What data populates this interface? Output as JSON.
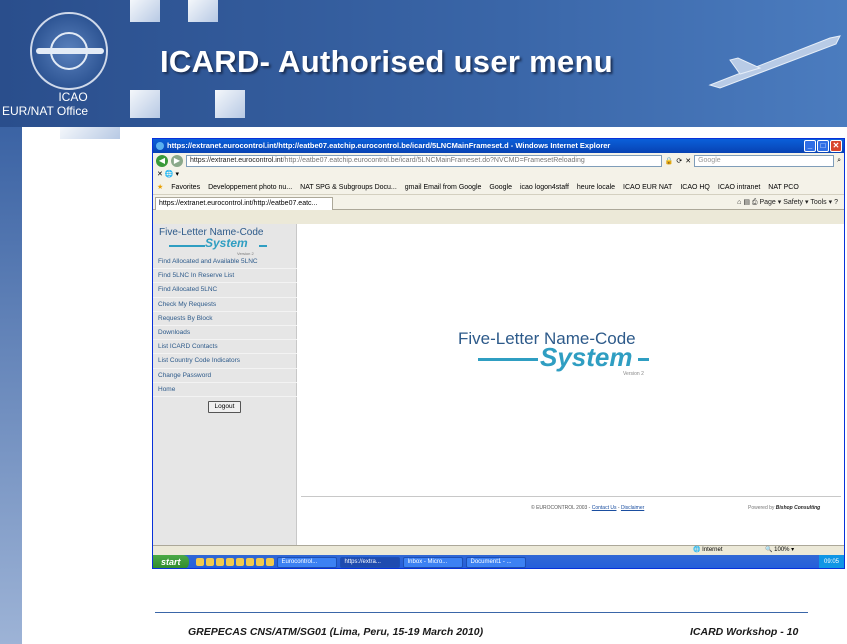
{
  "slide": {
    "title": "ICARD- Authorised user menu",
    "org_label": "ICAO",
    "office_label": "EUR/NAT Office",
    "footer_left": "GREPECAS  CNS/ATM/SG01 (Lima, Peru, 15-19 March 2010)",
    "footer_right": "ICARD Workshop - 10"
  },
  "browser": {
    "window_title": "https://extranet.eurocontrol.int/http://eatbe07.eatchip.eurocontrol.be/icard/5LNCMainFrameset.d - Windows Internet Explorer",
    "url_prefix": "https://extranet.eurocontrol.int",
    "url_rest": "/http://eatbe07.eatchip.eurocontrol.be/icard/5LNCMainFrameset.do?NVCMD=FramesetReloading",
    "search_placeholder": "Google",
    "menu_row": "✕  🌐 ▾",
    "favorites": [
      "Favorites",
      "Developpement photo nu...",
      "NAT SPG & Subgroups Docu...",
      "gmail Email from Google",
      "Google",
      "icao logon4staff",
      "heure locale",
      "ICAO EUR NAT",
      "ICAO HQ",
      "ICAO intranet",
      "NAT PCO"
    ],
    "tab_label": "https://extranet.eurocontrol.int/http://eatbe07.eatc...",
    "command_bar": "Page ▾  Safety ▾  Tools ▾",
    "status_zone": "Internet",
    "status_zoom": "100%"
  },
  "app": {
    "logo_line1": "Five-Letter Name-Code",
    "logo_line2": "System",
    "logo_version": "Version 2",
    "menu": [
      "Find Allocated and Available 5LNC",
      "Find 5LNC In Reserve List",
      "Find Allocated 5LNC",
      "Check My Requests",
      "Requests By Block",
      "Downloads",
      "List ICARD Contacts",
      "List Country Code Indicators",
      "Change Password",
      "Home"
    ],
    "logout_label": "Logout",
    "copyright": "© EUROCONTROL 2003 - ",
    "contact_link": "Contact Us",
    "disclaimer_link": "Disclaimer",
    "powered_by": "Powered by ",
    "powered_name": "Bishop Consulting"
  },
  "taskbar": {
    "start_label": "start",
    "tasks": [
      "Eurocontrol...",
      "https://extra...",
      "Inbox - Micro...",
      "Document1 - ..."
    ],
    "clock": "09:05"
  },
  "colors": {
    "slide_blue": "#2a4e8c",
    "logo_teal": "#2f9ec2",
    "link_blue": "#2d5a8a"
  }
}
